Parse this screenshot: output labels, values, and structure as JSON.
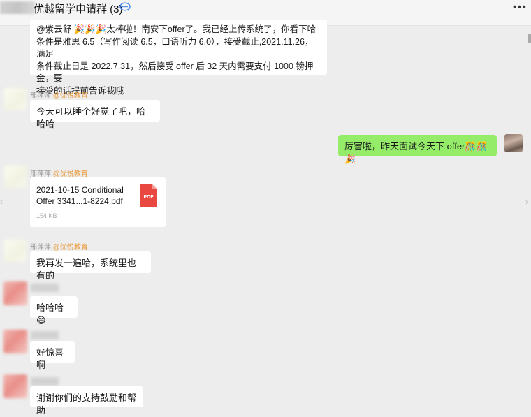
{
  "window": {
    "title": "优越留学申请群 (3)",
    "more_icon": "more-icon"
  },
  "messages": {
    "m1": {
      "lines": [
        "@紫云舒 🎉🎉🎉太棒啦！南安下offer了。我已经上传系统了，你看下哈",
        "条件是雅思 6.5（写作阅读 6.5，口语听力 6.0），接受截止,2021.11.26，满足",
        "条件截止日是 2022.7.31，然后接受 offer 后 32 天内需要支付 1000 镑押金，要",
        "接受的话提前告诉我哦"
      ]
    },
    "m2": {
      "sender_name": "邢萍萍",
      "sender_org": "@优悦教育",
      "text": "今天可以睡个好觉了吧，哈哈哈"
    },
    "m3": {
      "text": "厉害啦，昨天面试今天下 offer🎊🎊🎉"
    },
    "m4": {
      "sender_name": "邢萍萍",
      "sender_org": "@优悦教育",
      "file_name": "2021-10-15 Conditional Offer 3341...1-8224.pdf",
      "file_size": "154 KB",
      "file_badge": "PDF"
    },
    "m5": {
      "sender_name": "邢萍萍",
      "sender_org": "@优悦教育",
      "text": "我再发一遍哈，系统里也有的"
    },
    "m6": {
      "text": "哈哈哈😄"
    },
    "m7": {
      "text": "好惊喜啊"
    },
    "m8": {
      "text": "谢谢你们的支持鼓励和帮助"
    }
  },
  "colors": {
    "self_bubble": "#95ec69",
    "other_bubble": "#ffffff",
    "background": "#ededed",
    "org_tag": "#e99a3a",
    "pdf_red": "#e8483f"
  }
}
